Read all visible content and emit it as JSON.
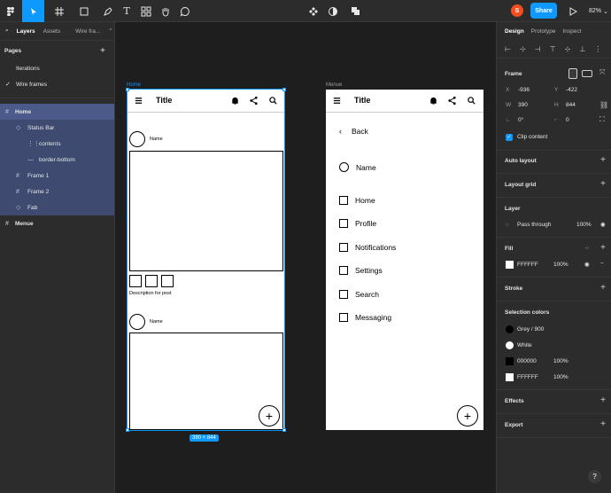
{
  "toolbar": {
    "avatar_initial": "S",
    "share_label": "Share",
    "zoom_label": "82%"
  },
  "left_panel": {
    "tabs": [
      "Layers",
      "Assets",
      "Wire fra..."
    ],
    "pages_title": "Pages",
    "pages": [
      {
        "label": "Iterations",
        "current": false
      },
      {
        "label": "Wire frames",
        "current": true
      }
    ],
    "layers": [
      {
        "label": "Home",
        "indent": 0,
        "icon": "#"
      },
      {
        "label": "Status Bar",
        "indent": 1,
        "icon": "◇"
      },
      {
        "label": "contents",
        "indent": 2,
        "icon": "⋮⋮"
      },
      {
        "label": "border-bottom",
        "indent": 2,
        "icon": "—"
      },
      {
        "label": "Frame 1",
        "indent": 1,
        "icon": "#"
      },
      {
        "label": "Frame 2",
        "indent": 1,
        "icon": "#"
      },
      {
        "label": "Fab",
        "indent": 1,
        "icon": "◇"
      },
      {
        "label": "Menue",
        "indent": 0,
        "icon": "#"
      }
    ]
  },
  "canvas": {
    "home_frame": {
      "label": "Home",
      "app_title": "Title",
      "post1_name": "Name",
      "description": "Description for post",
      "post2_name": "Name",
      "fab_label": "+",
      "size_badge": "390 × 844"
    },
    "menue_frame": {
      "label": "Menue",
      "app_title": "Title",
      "back_label": "Back",
      "name_label": "Name",
      "items": [
        "Home",
        "Profile",
        "Notifications",
        "Settings",
        "Search",
        "Messaging"
      ],
      "fab_label": "+"
    }
  },
  "right_panel": {
    "tabs": [
      "Design",
      "Prototype",
      "Inspect"
    ],
    "frame_title": "Frame",
    "x_label": "X",
    "x_value": "-936",
    "y_label": "Y",
    "y_value": "-422",
    "w_label": "W",
    "w_value": "390",
    "h_label": "H",
    "h_value": "844",
    "rotation_value": "0°",
    "radius_value": "0",
    "clip_content_label": "Clip content",
    "auto_layout": "Auto layout",
    "layout_grid": "Layout grid",
    "layer_title": "Layer",
    "blend_mode": "Pass through",
    "layer_opacity": "100%",
    "fill_title": "Fill",
    "fill_hex": "FFFFFF",
    "fill_opacity": "100%",
    "stroke_title": "Stroke",
    "selection_colors_title": "Selection colors",
    "selection_colors": [
      {
        "label": "Grey / 900",
        "color": "#000000",
        "shape": "circle",
        "opacity": ""
      },
      {
        "label": "White",
        "color": "#ffffff",
        "shape": "circle",
        "opacity": ""
      },
      {
        "label": "000000",
        "color": "#000000",
        "shape": "square",
        "opacity": "100%"
      },
      {
        "label": "FFFFFF",
        "color": "#ffffff",
        "shape": "square",
        "opacity": "100%"
      }
    ],
    "effects_title": "Effects",
    "export_title": "Export",
    "help_label": "?"
  }
}
